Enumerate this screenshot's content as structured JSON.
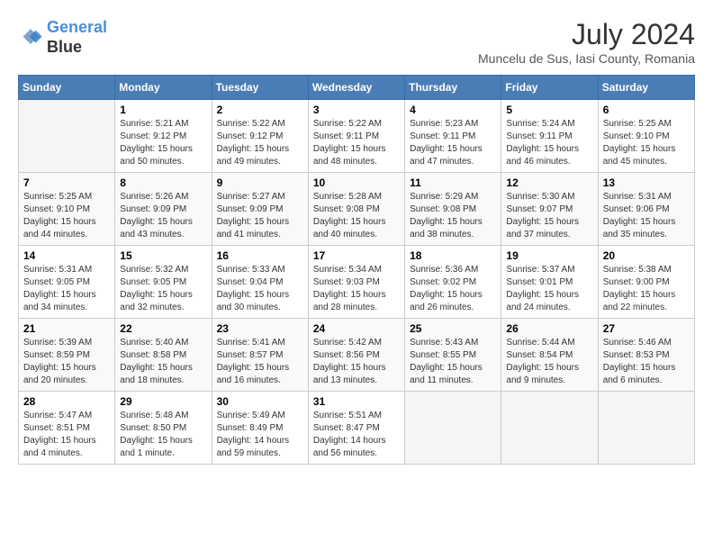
{
  "header": {
    "logo_line1": "General",
    "logo_line2": "Blue",
    "month_year": "July 2024",
    "location": "Muncelu de Sus, Iasi County, Romania"
  },
  "weekdays": [
    "Sunday",
    "Monday",
    "Tuesday",
    "Wednesday",
    "Thursday",
    "Friday",
    "Saturday"
  ],
  "weeks": [
    [
      {
        "day": "",
        "info": ""
      },
      {
        "day": "1",
        "info": "Sunrise: 5:21 AM\nSunset: 9:12 PM\nDaylight: 15 hours\nand 50 minutes."
      },
      {
        "day": "2",
        "info": "Sunrise: 5:22 AM\nSunset: 9:12 PM\nDaylight: 15 hours\nand 49 minutes."
      },
      {
        "day": "3",
        "info": "Sunrise: 5:22 AM\nSunset: 9:11 PM\nDaylight: 15 hours\nand 48 minutes."
      },
      {
        "day": "4",
        "info": "Sunrise: 5:23 AM\nSunset: 9:11 PM\nDaylight: 15 hours\nand 47 minutes."
      },
      {
        "day": "5",
        "info": "Sunrise: 5:24 AM\nSunset: 9:11 PM\nDaylight: 15 hours\nand 46 minutes."
      },
      {
        "day": "6",
        "info": "Sunrise: 5:25 AM\nSunset: 9:10 PM\nDaylight: 15 hours\nand 45 minutes."
      }
    ],
    [
      {
        "day": "7",
        "info": "Sunrise: 5:25 AM\nSunset: 9:10 PM\nDaylight: 15 hours\nand 44 minutes."
      },
      {
        "day": "8",
        "info": "Sunrise: 5:26 AM\nSunset: 9:09 PM\nDaylight: 15 hours\nand 43 minutes."
      },
      {
        "day": "9",
        "info": "Sunrise: 5:27 AM\nSunset: 9:09 PM\nDaylight: 15 hours\nand 41 minutes."
      },
      {
        "day": "10",
        "info": "Sunrise: 5:28 AM\nSunset: 9:08 PM\nDaylight: 15 hours\nand 40 minutes."
      },
      {
        "day": "11",
        "info": "Sunrise: 5:29 AM\nSunset: 9:08 PM\nDaylight: 15 hours\nand 38 minutes."
      },
      {
        "day": "12",
        "info": "Sunrise: 5:30 AM\nSunset: 9:07 PM\nDaylight: 15 hours\nand 37 minutes."
      },
      {
        "day": "13",
        "info": "Sunrise: 5:31 AM\nSunset: 9:06 PM\nDaylight: 15 hours\nand 35 minutes."
      }
    ],
    [
      {
        "day": "14",
        "info": "Sunrise: 5:31 AM\nSunset: 9:05 PM\nDaylight: 15 hours\nand 34 minutes."
      },
      {
        "day": "15",
        "info": "Sunrise: 5:32 AM\nSunset: 9:05 PM\nDaylight: 15 hours\nand 32 minutes."
      },
      {
        "day": "16",
        "info": "Sunrise: 5:33 AM\nSunset: 9:04 PM\nDaylight: 15 hours\nand 30 minutes."
      },
      {
        "day": "17",
        "info": "Sunrise: 5:34 AM\nSunset: 9:03 PM\nDaylight: 15 hours\nand 28 minutes."
      },
      {
        "day": "18",
        "info": "Sunrise: 5:36 AM\nSunset: 9:02 PM\nDaylight: 15 hours\nand 26 minutes."
      },
      {
        "day": "19",
        "info": "Sunrise: 5:37 AM\nSunset: 9:01 PM\nDaylight: 15 hours\nand 24 minutes."
      },
      {
        "day": "20",
        "info": "Sunrise: 5:38 AM\nSunset: 9:00 PM\nDaylight: 15 hours\nand 22 minutes."
      }
    ],
    [
      {
        "day": "21",
        "info": "Sunrise: 5:39 AM\nSunset: 8:59 PM\nDaylight: 15 hours\nand 20 minutes."
      },
      {
        "day": "22",
        "info": "Sunrise: 5:40 AM\nSunset: 8:58 PM\nDaylight: 15 hours\nand 18 minutes."
      },
      {
        "day": "23",
        "info": "Sunrise: 5:41 AM\nSunset: 8:57 PM\nDaylight: 15 hours\nand 16 minutes."
      },
      {
        "day": "24",
        "info": "Sunrise: 5:42 AM\nSunset: 8:56 PM\nDaylight: 15 hours\nand 13 minutes."
      },
      {
        "day": "25",
        "info": "Sunrise: 5:43 AM\nSunset: 8:55 PM\nDaylight: 15 hours\nand 11 minutes."
      },
      {
        "day": "26",
        "info": "Sunrise: 5:44 AM\nSunset: 8:54 PM\nDaylight: 15 hours\nand 9 minutes."
      },
      {
        "day": "27",
        "info": "Sunrise: 5:46 AM\nSunset: 8:53 PM\nDaylight: 15 hours\nand 6 minutes."
      }
    ],
    [
      {
        "day": "28",
        "info": "Sunrise: 5:47 AM\nSunset: 8:51 PM\nDaylight: 15 hours\nand 4 minutes."
      },
      {
        "day": "29",
        "info": "Sunrise: 5:48 AM\nSunset: 8:50 PM\nDaylight: 15 hours\nand 1 minute."
      },
      {
        "day": "30",
        "info": "Sunrise: 5:49 AM\nSunset: 8:49 PM\nDaylight: 14 hours\nand 59 minutes."
      },
      {
        "day": "31",
        "info": "Sunrise: 5:51 AM\nSunset: 8:47 PM\nDaylight: 14 hours\nand 56 minutes."
      },
      {
        "day": "",
        "info": ""
      },
      {
        "day": "",
        "info": ""
      },
      {
        "day": "",
        "info": ""
      }
    ]
  ]
}
